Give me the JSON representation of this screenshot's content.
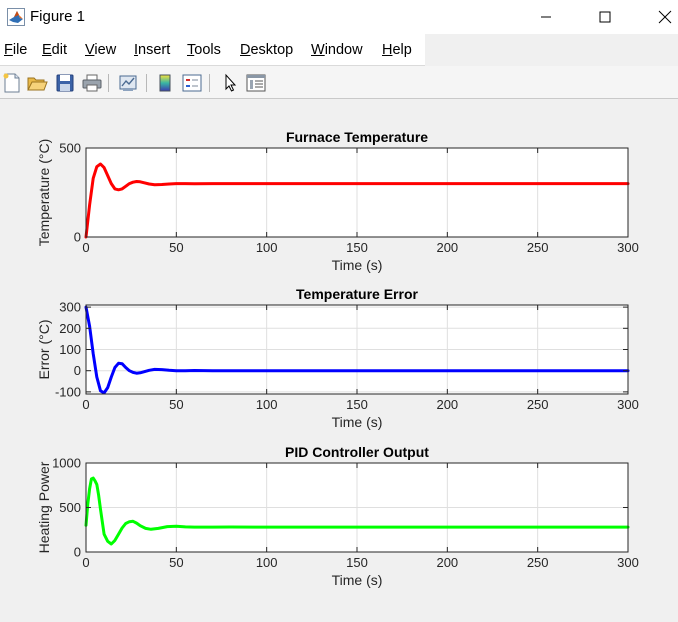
{
  "window": {
    "title": "Figure 1",
    "icon": "matlab-logo-icon",
    "controls": [
      "minimize-icon",
      "maximize-icon",
      "close-icon"
    ]
  },
  "menu": [
    {
      "label": "File",
      "mnemonic": "F",
      "rest": "ile"
    },
    {
      "label": "Edit",
      "mnemonic": "E",
      "rest": "dit"
    },
    {
      "label": "View",
      "mnemonic": "V",
      "rest": "iew"
    },
    {
      "label": "Insert",
      "mnemonic": "I",
      "rest": "nsert"
    },
    {
      "label": "Tools",
      "mnemonic": "T",
      "rest": "ools"
    },
    {
      "label": "Desktop",
      "mnemonic": "D",
      "rest": "esktop"
    },
    {
      "label": "Window",
      "mnemonic": "W",
      "rest": "indow"
    },
    {
      "label": "Help",
      "mnemonic": "H",
      "rest": "elp"
    }
  ],
  "toolbar": {
    "buttons": [
      "new-figure-icon",
      "open-file-icon",
      "save-icon",
      "print-icon",
      "link-plot-icon",
      "insert-colorbar-icon",
      "insert-legend-icon",
      "edit-plot-icon",
      "property-inspector-icon"
    ]
  },
  "colors": {
    "temperature_line": "#ff0000",
    "error_line": "#0000ff",
    "controller_line": "#00ff00",
    "axes_background": "#ffffff",
    "figure_background": "#f0f0f0",
    "grid": "#dfdfdf"
  },
  "chart_data": [
    {
      "type": "line",
      "title": "Furnace Temperature",
      "xlabel": "Time (s)",
      "ylabel": "Temperature (°C)",
      "xlim": [
        0,
        300
      ],
      "ylim": [
        0,
        500
      ],
      "xticks": [
        0,
        50,
        100,
        150,
        200,
        250,
        300
      ],
      "yticks": [
        0,
        500
      ],
      "grid": true,
      "series": [
        {
          "color": "#ff0000",
          "x": [
            0,
            2,
            4,
            6,
            8,
            10,
            12,
            14,
            16,
            18,
            20,
            22,
            24,
            26,
            28,
            30,
            32,
            35,
            38,
            42,
            46,
            50,
            55,
            60,
            70,
            80,
            100,
            150,
            200,
            250,
            300
          ],
          "y": [
            0,
            180,
            330,
            395,
            410,
            390,
            345,
            300,
            270,
            265,
            270,
            285,
            300,
            308,
            312,
            310,
            305,
            298,
            294,
            295,
            298,
            300,
            300,
            299,
            300,
            300,
            300,
            300,
            300,
            300,
            300
          ]
        }
      ]
    },
    {
      "type": "line",
      "title": "Temperature Error",
      "xlabel": "Time (s)",
      "ylabel": "Error (°C)",
      "xlim": [
        0,
        300
      ],
      "ylim": [
        -110,
        310
      ],
      "xticks": [
        0,
        50,
        100,
        150,
        200,
        250,
        300
      ],
      "yticks": [
        -100,
        0,
        100,
        200,
        300
      ],
      "grid": true,
      "series": [
        {
          "color": "#0000ff",
          "x": [
            0,
            2,
            4,
            6,
            8,
            10,
            12,
            14,
            16,
            18,
            20,
            22,
            24,
            26,
            28,
            30,
            32,
            35,
            38,
            42,
            46,
            50,
            55,
            60,
            70,
            80,
            100,
            150,
            200,
            250,
            300
          ],
          "y": [
            300,
            210,
            80,
            -30,
            -95,
            -105,
            -80,
            -30,
            15,
            35,
            33,
            15,
            0,
            -8,
            -12,
            -10,
            -5,
            2,
            6,
            5,
            2,
            0,
            0,
            1,
            0,
            0,
            0,
            0,
            0,
            0,
            0
          ]
        }
      ]
    },
    {
      "type": "line",
      "title": "PID Controller Output",
      "xlabel": "Time (s)",
      "ylabel": "Heating Power",
      "xlim": [
        0,
        300
      ],
      "ylim": [
        0,
        1000
      ],
      "xticks": [
        0,
        50,
        100,
        150,
        200,
        250,
        300
      ],
      "yticks": [
        0,
        500,
        1000
      ],
      "grid": true,
      "series": [
        {
          "color": "#00ff00",
          "x": [
            0,
            1,
            2,
            3,
            4,
            5,
            6,
            7,
            8,
            10,
            12,
            14,
            16,
            18,
            20,
            22,
            24,
            26,
            28,
            30,
            33,
            36,
            40,
            45,
            50,
            55,
            60,
            70,
            80,
            100,
            150,
            200,
            250,
            300
          ],
          "y": [
            300,
            540,
            710,
            820,
            830,
            800,
            760,
            640,
            480,
            200,
            120,
            90,
            130,
            200,
            270,
            320,
            340,
            345,
            325,
            295,
            265,
            255,
            265,
            285,
            290,
            282,
            280,
            280,
            281,
            280,
            280,
            280,
            280,
            280
          ]
        }
      ]
    }
  ]
}
